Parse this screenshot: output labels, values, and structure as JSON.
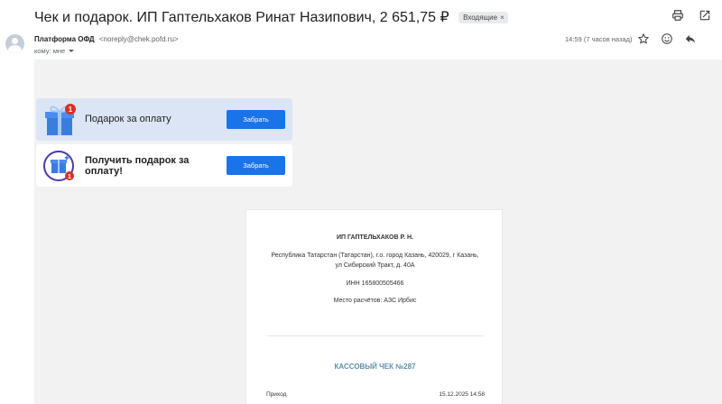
{
  "email": {
    "subject": "Чек и подарок. ИП Гаптельхаков Ринат Назипович, 2 651,75 ₽",
    "label_chip": "Входящие",
    "chip_close": "×",
    "sender_name": "Платформа ОФД",
    "sender_email": "<noreply@chek.pofd.ru>",
    "recipient": "кому: мне",
    "time": "14:59 (7 часов назад)"
  },
  "icons": {
    "top": [
      "print-icon",
      "open-in-new-window-icon"
    ],
    "actions": [
      "star-icon",
      "emoji-react-icon",
      "reply-icon"
    ]
  },
  "promos": [
    {
      "title": "Подарок за оплату",
      "button": "Забрать",
      "badge": "1"
    },
    {
      "title": "Получить подарок за оплату!",
      "button": "Забрать",
      "badge": "1"
    }
  ],
  "receipt": {
    "org": "ИП ГАПТЕЛЬХАКОВ Р. Н.",
    "address": "Республика Татарстан (Татарстан), г.о. город Казань, 420029, г Казань, ул Сибирский Тракт, д. 40А",
    "inn": "ИНН 165800505466",
    "place": "Место расчётов: АЗС Ирбис",
    "title": "КАССОВЫЙ ЧЕК №287",
    "row_label": "Приход",
    "row_value": "15.12.2025 14:58"
  },
  "colors": {
    "accent": "#1a73e8",
    "promo_bg": "#dbe5f5",
    "receipt_title": "#5e8fa8",
    "badge": "#d93025"
  }
}
